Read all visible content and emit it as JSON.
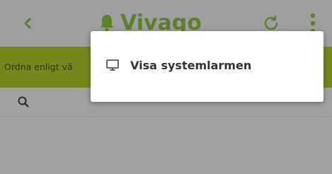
{
  "app": {
    "brand_name": "Vivago"
  },
  "toolbar": {
    "back_icon": "chevron-left-icon",
    "refresh_icon": "refresh-icon",
    "more_icon": "more-vertical-icon"
  },
  "sortbar": {
    "label": "Ordna enligt vä"
  },
  "search": {
    "icon": "search-icon"
  },
  "menu": {
    "items": [
      {
        "label": "Visa systemlarmen",
        "icon": "monitor-icon"
      }
    ]
  },
  "colors": {
    "brand_green": "#8fc63f",
    "sortbar_green": "#b7ce2a"
  }
}
